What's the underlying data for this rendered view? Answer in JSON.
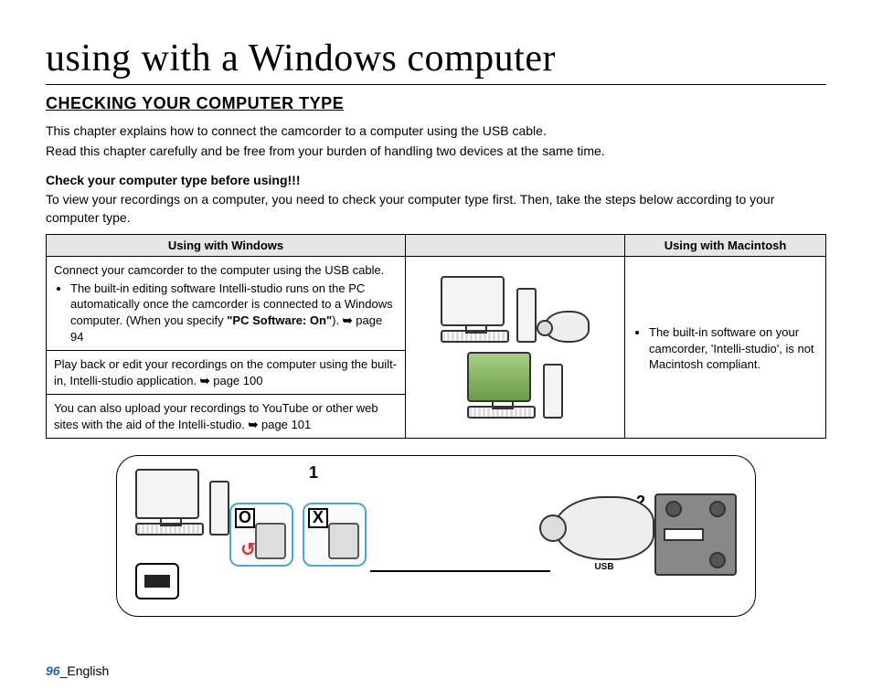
{
  "page_title": "using with a Windows computer",
  "section_heading": "CHECKING YOUR COMPUTER TYPE",
  "intro_line1": "This chapter explains how to connect the camcorder to a computer using the USB cable.",
  "intro_line2": "Read this chapter carefully and be free from your burden of handling two devices at the same time.",
  "check_heading": "Check your computer type before using!!!",
  "check_text": "To view your recordings on a computer, you need to check your computer type first. Then, take the steps below according to your computer type.",
  "table": {
    "header_windows": "Using with Windows",
    "header_macintosh": "Using with Macintosh",
    "win_cell1_intro": "Connect your camcorder to the computer using the USB cable.",
    "win_cell1_bullet": "The built-in editing software Intelli-studio runs on the PC automatically once the camcorder is connected to a Windows computer. (When you specify ",
    "win_cell1_bold": "\"PC Software: On\"",
    "win_cell1_tail": "). ",
    "win_cell1_ref": "page 94",
    "win_cell2": "Play back or edit your recordings on the computer using the built-in, Intelli-studio application. ",
    "win_cell2_ref": "page 100",
    "win_cell3": "You can also upload your recordings to YouTube or other web sites with the aid of  the Intelli-studio. ",
    "win_cell3_ref": "page 101",
    "mac_bullet": "The built-in software on your camcorder, 'Intelli-studio', is not Macintosh compliant."
  },
  "diagram": {
    "step1": "1",
    "step2": "2",
    "inset_o": "O",
    "inset_x": "X",
    "usb_label": "USB"
  },
  "footer": {
    "page_number": "96",
    "page_lang": "_English"
  },
  "icons": {
    "arrow": "➥"
  }
}
